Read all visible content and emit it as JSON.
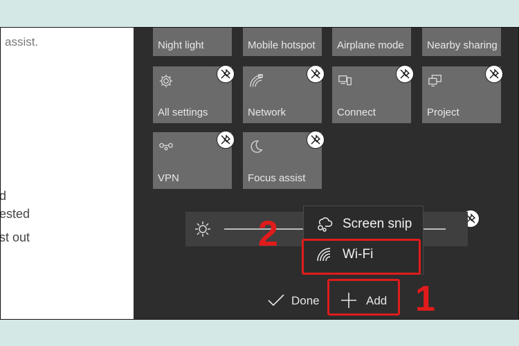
{
  "left_panel": {
    "lines": [
      "assist.",
      "d",
      "ested",
      "st out"
    ]
  },
  "tiles": [
    {
      "label": "Night light",
      "icon": "night-light-icon"
    },
    {
      "label": "Mobile hotspot",
      "icon": "hotspot-icon"
    },
    {
      "label": "Airplane mode",
      "icon": "airplane-icon"
    },
    {
      "label": "Nearby sharing",
      "icon": "share-icon"
    },
    {
      "label": "All settings",
      "icon": "gear-icon"
    },
    {
      "label": "Network",
      "icon": "network-icon"
    },
    {
      "label": "Connect",
      "icon": "connect-icon"
    },
    {
      "label": "Project",
      "icon": "project-icon"
    },
    {
      "label": "VPN",
      "icon": "vpn-icon"
    },
    {
      "label": "Focus assist",
      "icon": "moon-icon"
    }
  ],
  "brightness": {
    "icon": "sun-icon"
  },
  "add_menu": {
    "items": [
      {
        "label": "Screen snip",
        "icon": "screen-snip-icon"
      },
      {
        "label": "Wi-Fi",
        "icon": "wifi-icon"
      }
    ]
  },
  "actions": {
    "done_label": "Done",
    "add_label": "Add"
  },
  "annotations": {
    "step_1": "1",
    "step_2": "2",
    "color": "#e11b1b"
  },
  "colors": {
    "background": "#d4e8e5",
    "panel": "#2d2d2d",
    "tile": "#6b6b6b"
  }
}
